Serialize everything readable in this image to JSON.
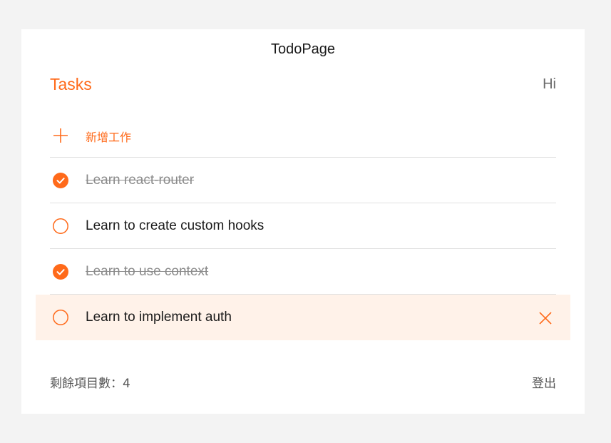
{
  "page": {
    "title": "TodoPage"
  },
  "header": {
    "heading": "Tasks",
    "greeting": "Hi"
  },
  "add_task": {
    "label": "新增工作",
    "icon": "plus-icon"
  },
  "tasks": [
    {
      "text": "Learn react-router",
      "completed": true
    },
    {
      "text": "Learn to create custom hooks",
      "completed": false
    },
    {
      "text": "Learn to use context",
      "completed": true
    },
    {
      "text": "Learn to implement auth",
      "completed": false,
      "hovered": true
    }
  ],
  "footer": {
    "remaining": "剩餘項目數：4",
    "logout": "登出"
  },
  "colors": {
    "accent": "#ff6a1a",
    "hover_bg": "#fff2e9",
    "background": "#f3f3f3",
    "card": "#ffffff"
  }
}
